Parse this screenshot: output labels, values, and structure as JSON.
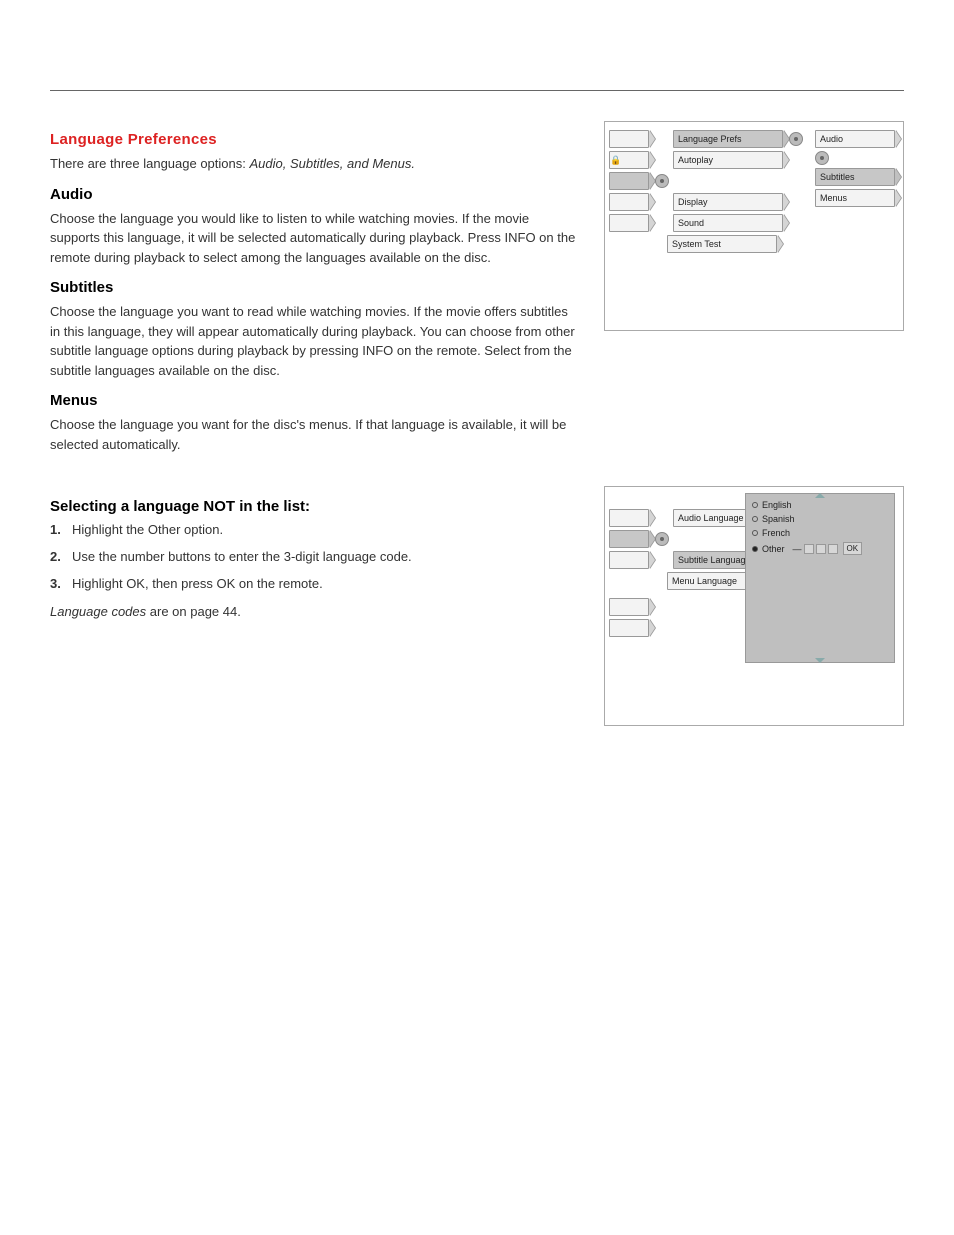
{
  "header_spacer": "",
  "section1": {
    "heading": "Language Preferences",
    "p1": "There are three language options: ",
    "p1_labels": "Audio, Subtitles, and Menus.",
    "audio": {
      "title": "Audio",
      "text": "Choose the language you would like to listen to while watching movies. If the movie supports this language, it will be selected automatically during playback. Press INFO on the remote during playback to select among the languages available on the disc."
    },
    "subtitles": {
      "title": "Subtitles",
      "text": "Choose the language you want to read while watching movies. If the movie offers subtitles in this language, they will appear automatically during playback. You can choose from other subtitle language options during playback by pressing INFO on the remote. Select from the subtitle languages available on the disc."
    },
    "menus": {
      "title": "Menus",
      "text": "Choose the language you want for the disc's menus. If that language is available, it will be selected automatically."
    }
  },
  "fig1": {
    "left_blank_rows": [
      "",
      "",
      "",
      "",
      ""
    ],
    "lock_icon": "🔒",
    "left_items": [
      "Language Prefs",
      "Autoplay",
      "Display",
      "Sound",
      "System Test"
    ],
    "knob_rows": [
      false,
      false,
      true,
      false,
      false
    ],
    "right_items": [
      "Audio",
      "Subtitles",
      "Menus"
    ]
  },
  "section2": {
    "heading": "Selecting a language NOT in the list:",
    "steps": [
      {
        "n": "1.",
        "text_a": "Highlight the ",
        "label": "Other",
        "text_b": " option."
      },
      {
        "n": "2.",
        "text_a": "Use the number buttons to enter the 3-digit language code.",
        "label": "",
        "text_b": ""
      },
      {
        "n": "3.",
        "text_a": "Highlight OK, then press OK on the remote.",
        "label": "",
        "text_b": ""
      }
    ],
    "note_label": "Language codes",
    "note_text": " are on page 44."
  },
  "fig2": {
    "left_items": [
      "Audio Language",
      "Subtitle Language",
      "Menu Language"
    ],
    "radio": {
      "options": [
        "English",
        "Spanish",
        "French",
        "Other"
      ],
      "selected": "Other",
      "ok": "OK",
      "dash": "—"
    }
  }
}
